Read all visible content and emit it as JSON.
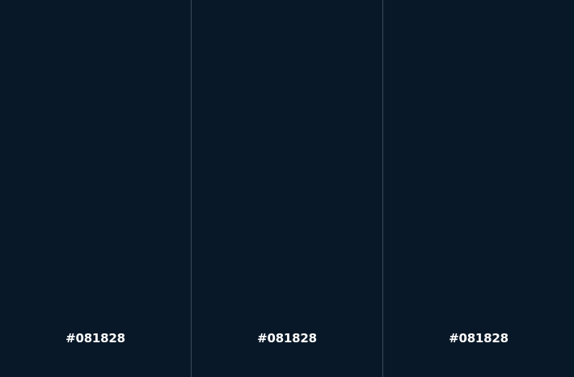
{
  "swatches": [
    {
      "label": "#081828",
      "color": "#081828"
    },
    {
      "label": "#081828",
      "color": "#081828"
    },
    {
      "label": "#081828",
      "color": "#081828"
    }
  ],
  "colors": {
    "divider": "#3a4a5a",
    "text": "#ffffff"
  }
}
